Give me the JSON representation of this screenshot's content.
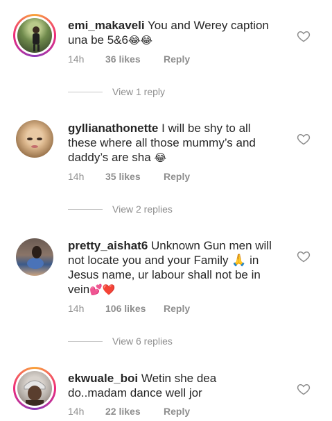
{
  "comments": [
    {
      "username": "emi_makaveli",
      "text": " You and Werey caption una be 5&6",
      "emoji": "😂😂",
      "time": "14h",
      "likes": "36 likes",
      "reply": "Reply",
      "replies_label": "View 1 reply",
      "avatar_colors": [
        "#6f8a4c",
        "#2d3a24"
      ]
    },
    {
      "username": "gyllianathonette",
      "text": " I will be shy to all these where all those mummy’s and daddy’s are sha ",
      "emoji": "😂",
      "time": "14h",
      "likes": "35 likes",
      "reply": "Reply",
      "replies_label": "View 2 replies",
      "avatar_colors": [
        "#d9b48a",
        "#7a5638"
      ]
    },
    {
      "username": "pretty_aishat6",
      "text": " Unknown Gun men will not locate you and your Family 🙏 in Jesus name, ur labour shall not be in vein",
      "emoji": "💕❤️",
      "time": "14h",
      "likes": "106 likes",
      "reply": "Reply",
      "replies_label": "View 6 replies",
      "avatar_colors": [
        "#8a7568",
        "#3b5a8a"
      ]
    },
    {
      "username": "ekwuale_boi",
      "text": " Wetin she dea do..madam dance well jor",
      "emoji": "",
      "time": "14h",
      "likes": "22 likes",
      "reply": "Reply",
      "avatar_colors": [
        "#b8b2ac",
        "#4a3528"
      ]
    }
  ]
}
